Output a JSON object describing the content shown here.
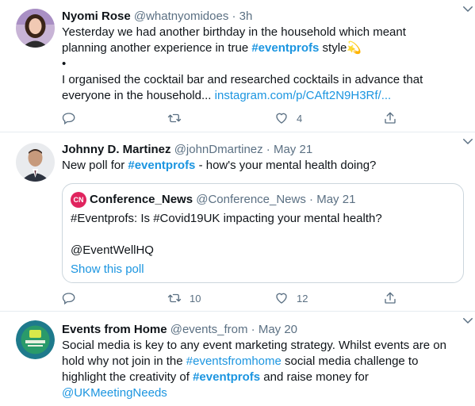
{
  "tweets": [
    {
      "name": "Nyomi Rose",
      "handle": "@whatnyomidoes",
      "separator": "·",
      "time": "3h",
      "line1": "Yesterday we had another birthday in the household which meant",
      "line2_prefix": "planning another experience in true ",
      "line2_hashtag": "#eventprofs",
      "line2_suffix": " style",
      "line2_emoji": "💫",
      "bullet": "•",
      "line4": "I organised the cocktail bar and researched cocktails in advance that",
      "line5_prefix": "everyone in the household... ",
      "line5_link": "instagram.com/p/CAft2N9H3Rf/...",
      "reply_count": "",
      "retweet_count": "",
      "like_count": "4",
      "icons": {
        "reply": "reply-icon",
        "retweet": "retweet-icon",
        "like": "heart-icon",
        "share": "share-icon",
        "caret": "chevron-down-icon"
      }
    },
    {
      "name": "Johnny D. Martinez",
      "handle": "@johnDmartinez",
      "separator": "·",
      "time": "May 21",
      "text_prefix": "New poll for ",
      "text_hashtag": "#eventprofs",
      "text_suffix": " - how's your mental health doing?",
      "quote": {
        "logo_text": "CN",
        "name": "Conference_News",
        "handle": "@Conference_News",
        "separator": "·",
        "time": "May 21",
        "body": "#Eventprofs: Is #Covid19UK impacting your mental health?",
        "mention": "@EventWellHQ",
        "poll_link": "Show this poll"
      },
      "reply_count": "",
      "retweet_count": "10",
      "like_count": "12"
    },
    {
      "name": "Events from Home",
      "handle": "@events_from",
      "separator": "·",
      "time": "May 20",
      "line1": "Social media is key to any event marketing strategy. Whilst events are on",
      "line2_prefix": "hold why not join in the ",
      "line2_hashtag": "#eventsfromhome",
      "line2_suffix": " social media challenge to",
      "line3_prefix": "highlight the creativity of ",
      "line3_hashtag": "#eventprofs",
      "line3_suffix": " and raise money for",
      "line4_mention": "@UKMeetingNeeds"
    }
  ],
  "colors": {
    "link": "#1b95e0",
    "muted": "#5b7083",
    "divider": "#e6ecf0",
    "quote_logo": "#e0245e"
  }
}
